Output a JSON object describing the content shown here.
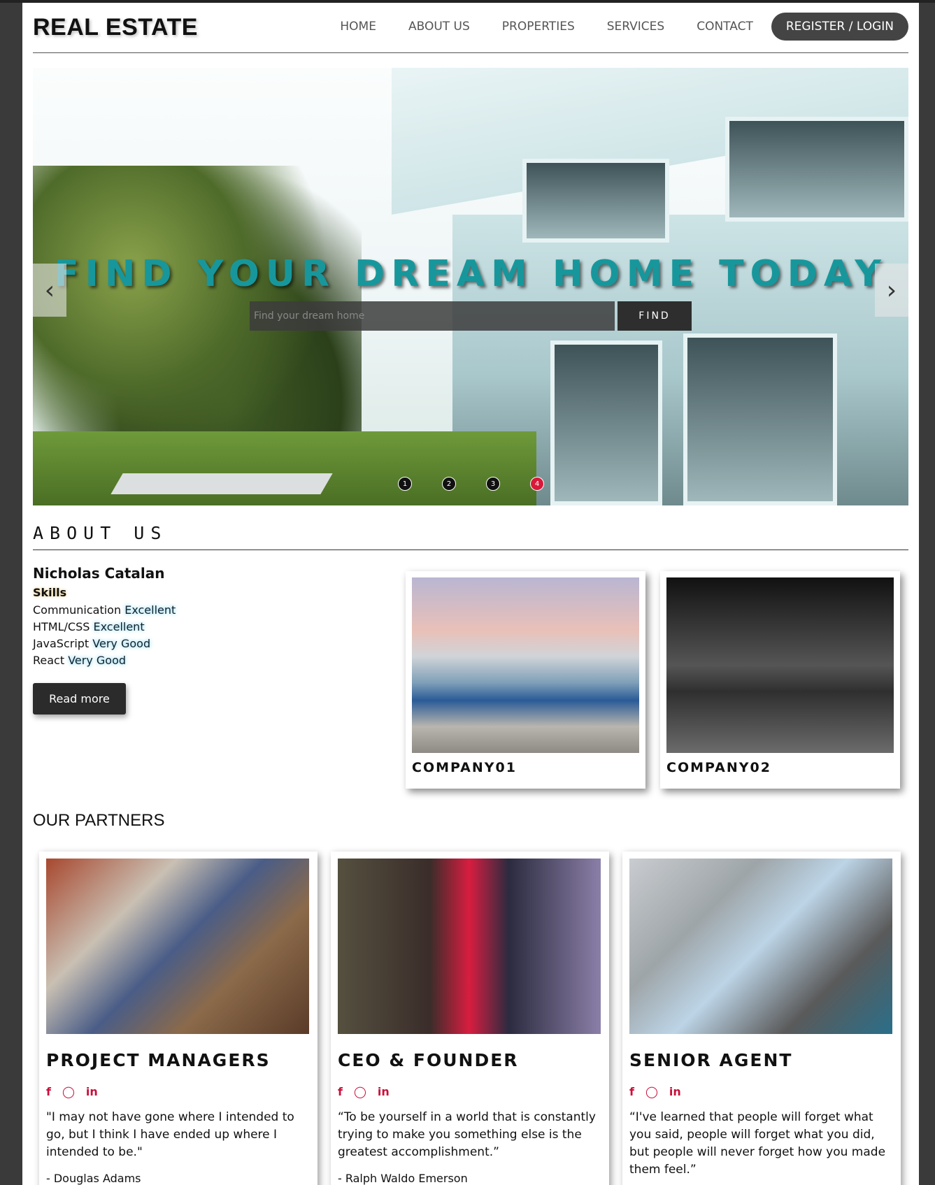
{
  "header": {
    "brand": "REAL ESTATE",
    "nav": [
      "HOME",
      "ABOUT US",
      "PROPERTIES",
      "SERVICES",
      "CONTACT"
    ],
    "login_label": "REGISTER / LOGIN"
  },
  "hero": {
    "title": "FIND YOUR DREAM HOME TODAY",
    "search_placeholder": "Find your dream home",
    "find_label": "FIND",
    "prev_icon": "chevron-left-icon",
    "next_icon": "chevron-right-icon",
    "slides": [
      "1",
      "2",
      "3",
      "4"
    ],
    "active_slide": 4
  },
  "about": {
    "title": "ABOUT US",
    "name": "Nicholas Catalan",
    "skills_label": "Skills",
    "skills": [
      {
        "skill": "Communication",
        "level": "Excellent"
      },
      {
        "skill": "HTML/CSS",
        "level": "Excellent"
      },
      {
        "skill": "JavaScript",
        "level": "Very Good"
      },
      {
        "skill": "React",
        "level": "Very Good"
      }
    ],
    "read_more": "Read more",
    "companies": [
      "COMPANY01",
      "COMPANY02"
    ]
  },
  "partners": {
    "title": "OUR PARTNERS",
    "cards": [
      {
        "role": "PROJECT MANAGERS",
        "quote": "\"I may not have gone where I intended to go, but I think I have ended up where I intended to be.\"",
        "author": "- Douglas Adams"
      },
      {
        "role": "CEO & FOUNDER",
        "quote": "“To be yourself in a world that is constantly trying to make you something else is the greatest accomplishment.”",
        "author": "- Ralph Waldo Emerson"
      },
      {
        "role": "SENIOR AGENT",
        "quote": "“I've learned that people will forget what you said, people will forget what you did, but people will never forget how you made them feel.”",
        "author": ""
      }
    ],
    "social_icons": [
      "facebook-icon",
      "github-icon",
      "linkedin-icon"
    ],
    "social_glyphs": [
      "f",
      "◯",
      "in"
    ]
  },
  "colors": {
    "accent": "#17979b",
    "dark": "#2b2b2b",
    "social": "#c8103a",
    "active_dot": "#d8193a"
  }
}
